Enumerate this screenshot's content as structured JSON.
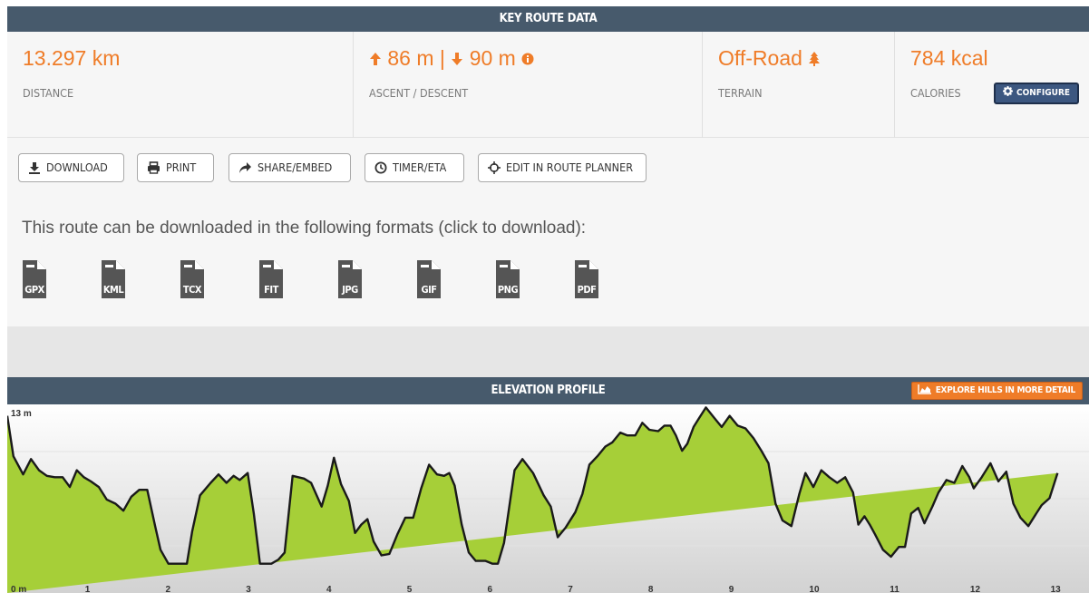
{
  "key_route": {
    "title": "KEY ROUTE DATA",
    "distance": {
      "value": "13.297 km",
      "label": "DISTANCE"
    },
    "ascent_descent": {
      "ascent": "86 m",
      "separator": "|",
      "descent": "90 m",
      "label": "ASCENT / DESCENT"
    },
    "terrain": {
      "value": "Off-Road",
      "label": "TERRAIN"
    },
    "calories": {
      "value": "784 kcal",
      "label": "CALORIES",
      "configure_label": "CONFIGURE"
    }
  },
  "toolbar": {
    "download": "DOWNLOAD",
    "print": "PRINT",
    "share": "SHARE/EMBED",
    "timer": "TIMER/ETA",
    "edit": "EDIT IN ROUTE PLANNER"
  },
  "formats": {
    "note": "This route can be downloaded in the following formats (click to download):",
    "items": [
      "GPX",
      "KML",
      "TCX",
      "FIT",
      "JPG",
      "GIF",
      "PNG",
      "PDF"
    ]
  },
  "elevation": {
    "title": "ELEVATION PROFILE",
    "explore_label": "EXPLORE HILLS IN MORE DETAIL"
  },
  "colors": {
    "accent": "#ef7c28",
    "header": "#475a6c",
    "fill": "#a6cf38",
    "configure": "#3c5780"
  },
  "chart_data": {
    "type": "area",
    "ylabel_top": "13 m",
    "x_ticks": [
      "0 m",
      "1",
      "2",
      "3",
      "4",
      "5",
      "6",
      "7",
      "8",
      "9",
      "10",
      "11",
      "12",
      "13"
    ],
    "xlim": [
      0,
      13.297
    ],
    "ylim": [
      0,
      13
    ],
    "x": [
      0,
      0.077,
      0.197,
      0.295,
      0.394,
      0.492,
      0.591,
      0.689,
      0.777,
      0.864,
      0.952,
      1.039,
      1.138,
      1.236,
      1.345,
      1.444,
      1.542,
      1.641,
      1.74,
      1.838,
      1.904,
      2.002,
      2.068,
      2.166,
      2.232,
      2.298,
      2.396,
      2.528,
      2.626,
      2.725,
      2.813,
      2.889,
      2.988,
      3.064,
      3.141,
      3.217,
      3.283,
      3.371,
      3.447,
      3.546,
      3.688,
      3.776,
      3.907,
      3.983,
      4.06,
      4.148,
      4.246,
      4.323,
      4.399,
      4.476,
      4.552,
      4.651,
      4.749,
      4.848,
      4.947,
      5.045,
      5.144,
      5.242,
      5.341,
      5.429,
      5.494,
      5.56,
      5.648,
      5.736,
      5.823,
      5.944,
      6.031,
      6.097,
      6.174,
      6.305,
      6.403,
      6.535,
      6.666,
      6.754,
      6.841,
      6.94,
      7.06,
      7.148,
      7.235,
      7.334,
      7.433,
      7.521,
      7.619,
      7.707,
      7.805,
      7.893,
      7.981,
      8.09,
      8.167,
      8.243,
      8.309,
      8.386,
      8.452,
      8.529,
      8.594,
      8.682,
      8.781,
      8.879,
      8.978,
      9.077,
      9.175,
      9.274,
      9.372,
      9.46,
      9.548,
      9.635,
      9.745,
      9.843,
      9.92,
      10.018,
      10.117,
      10.216,
      10.314,
      10.413,
      10.511,
      10.577,
      10.653,
      10.719,
      10.785,
      10.883,
      10.982,
      11.081,
      11.157,
      11.234,
      11.321,
      11.398,
      11.497,
      11.573,
      11.672,
      11.77,
      11.869,
      11.956,
      12.011,
      12.11,
      12.219,
      12.318,
      12.416,
      12.504,
      12.592,
      12.69,
      12.778,
      12.855,
      12.953,
      13.052,
      13.15,
      13.238,
      13.297
    ],
    "y": [
      12.7,
      9.8,
      8.5,
      9.6,
      8.8,
      8.4,
      8.3,
      8.3,
      7.6,
      8.8,
      8.3,
      8.0,
      7.6,
      6.7,
      6.4,
      5.9,
      6.9,
      7.4,
      7.4,
      4.8,
      3.1,
      2.1,
      2.1,
      2.1,
      2.1,
      4.4,
      7.0,
      7.9,
      8.5,
      7.9,
      8.4,
      8.1,
      8.6,
      5.7,
      2.1,
      2.1,
      2.1,
      2.4,
      2.9,
      8.4,
      8.2,
      7.9,
      6.2,
      7.7,
      9.7,
      7.8,
      6.6,
      4.3,
      4.9,
      5.3,
      3.7,
      2.7,
      2.8,
      4.2,
      5.4,
      5.4,
      7.5,
      9.2,
      8.5,
      8.4,
      8.6,
      7.7,
      4.9,
      2.9,
      2.3,
      2.3,
      2.1,
      2.1,
      3.6,
      8.8,
      9.6,
      8.6,
      7.0,
      6.2,
      4.0,
      4.7,
      5.8,
      7.1,
      9.2,
      9.8,
      10.5,
      10.8,
      11.5,
      11.3,
      11.3,
      12.2,
      11.7,
      11.6,
      12.0,
      12.0,
      11.3,
      10.2,
      10.7,
      11.9,
      12.5,
      13.3,
      12.6,
      11.9,
      12.7,
      12.0,
      11.8,
      11.1,
      10.2,
      9.3,
      6.4,
      5.2,
      4.8,
      7.1,
      8.6,
      7.6,
      8.8,
      8.3,
      7.9,
      8.3,
      7.2,
      4.9,
      5.5,
      4.9,
      4.2,
      3.1,
      2.6,
      3.3,
      3.3,
      5.7,
      6.1,
      5.0,
      6.2,
      7.2,
      8.1,
      7.9,
      9.1,
      8.3,
      7.5,
      8.3,
      9.3,
      8.0,
      8.7,
      6.4,
      5.4,
      4.8,
      5.6,
      6.3,
      6.8,
      8.6
    ]
  }
}
